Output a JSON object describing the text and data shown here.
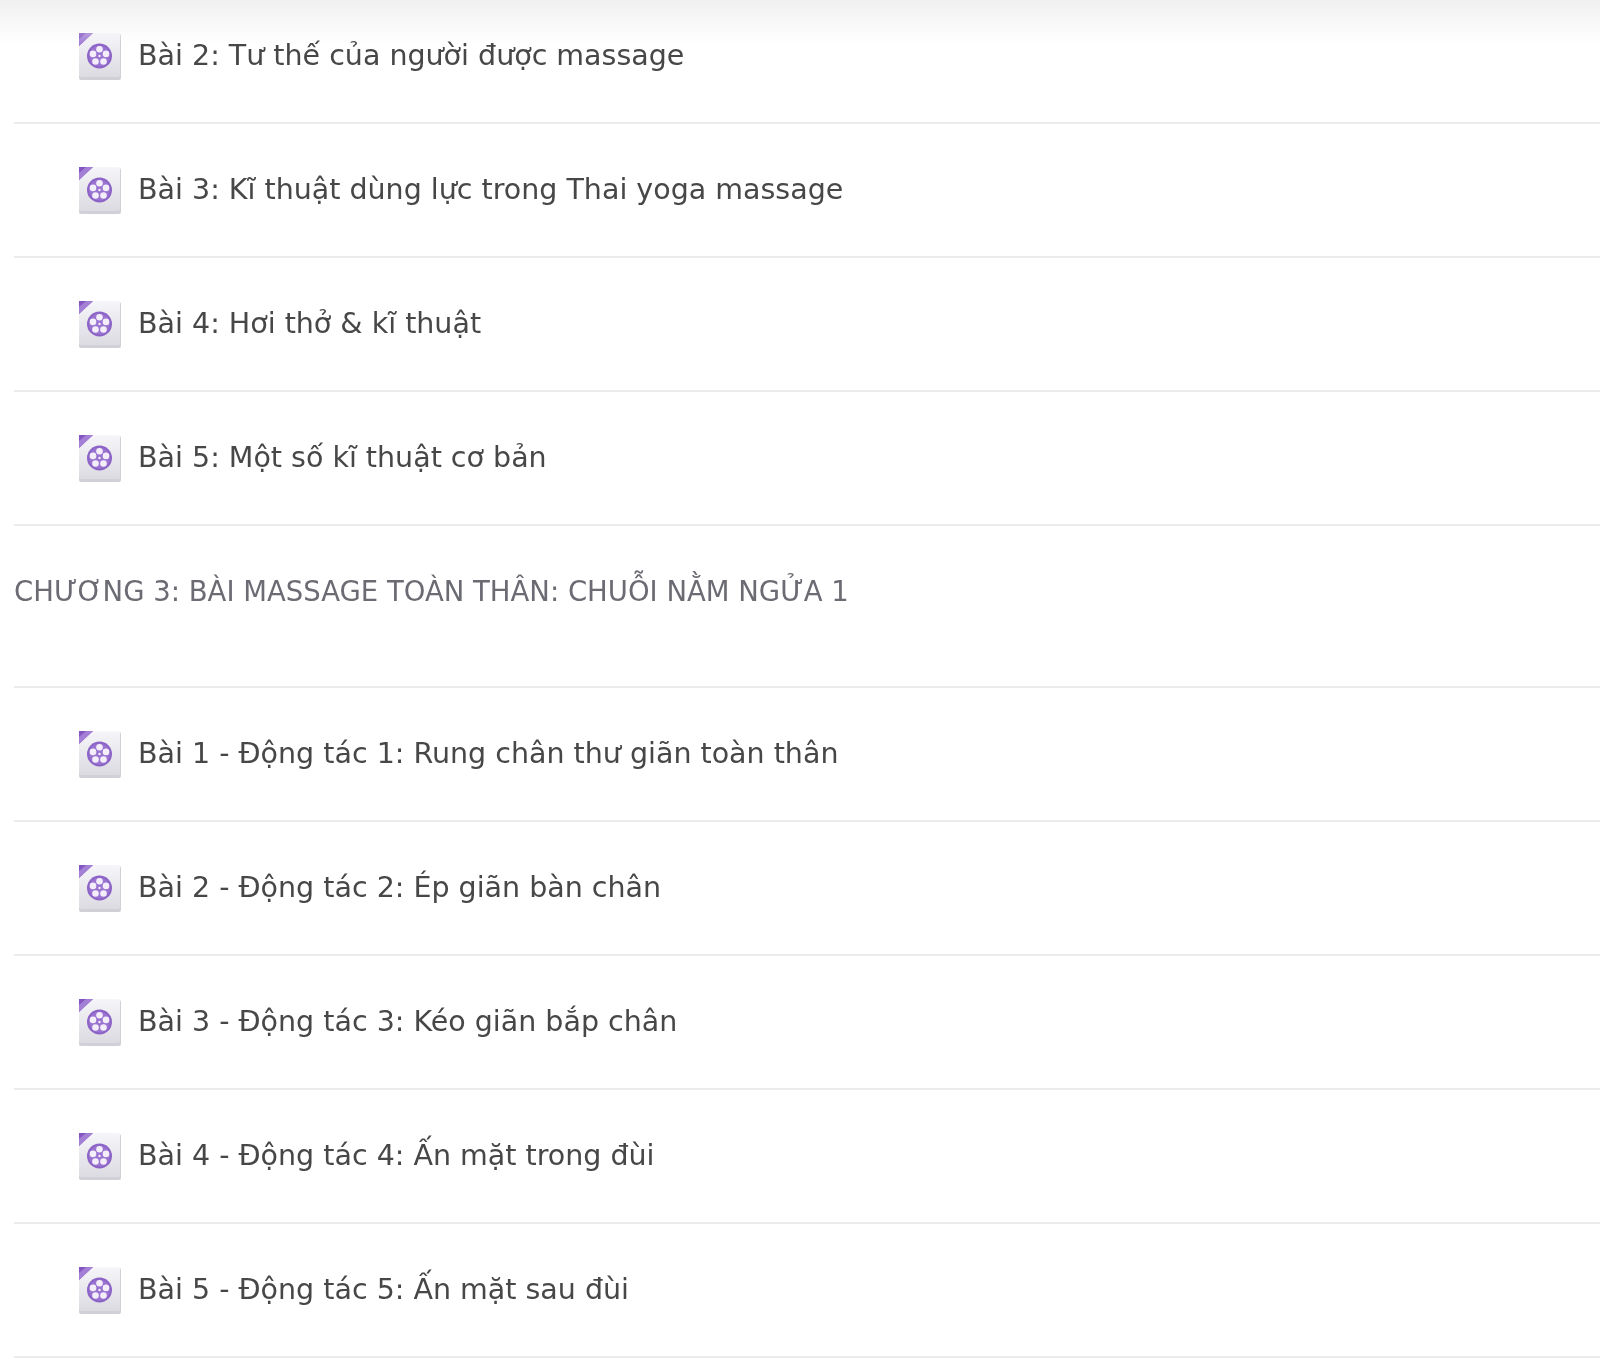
{
  "sections": [
    {
      "lessons": [
        {
          "title": "Bài 2: Tư thế của người được massage"
        },
        {
          "title": "Bài 3: Kĩ thuật dùng lực trong Thai yoga massage"
        },
        {
          "title": "Bài 4: Hơi thở & kĩ thuật"
        },
        {
          "title": "Bài 5: Một số kĩ thuật cơ bản"
        }
      ]
    },
    {
      "heading": "CHƯƠNG 3: BÀI MASSAGE TOÀN THÂN: CHUỖI NẰM NGỬA 1",
      "lessons": [
        {
          "title": "Bài 1 - Động tác 1: Rung chân thư giãn toàn thân"
        },
        {
          "title": "Bài 2 - Động tác 2: Ép giãn bàn chân"
        },
        {
          "title": "Bài 3 - Động tác 3: Kéo giãn bắp chân"
        },
        {
          "title": "Bài 4 - Động tác 4: Ấn mặt trong đùi"
        },
        {
          "title": "Bài 5 - Động tác 5: Ấn mặt sau đùi"
        }
      ]
    }
  ]
}
